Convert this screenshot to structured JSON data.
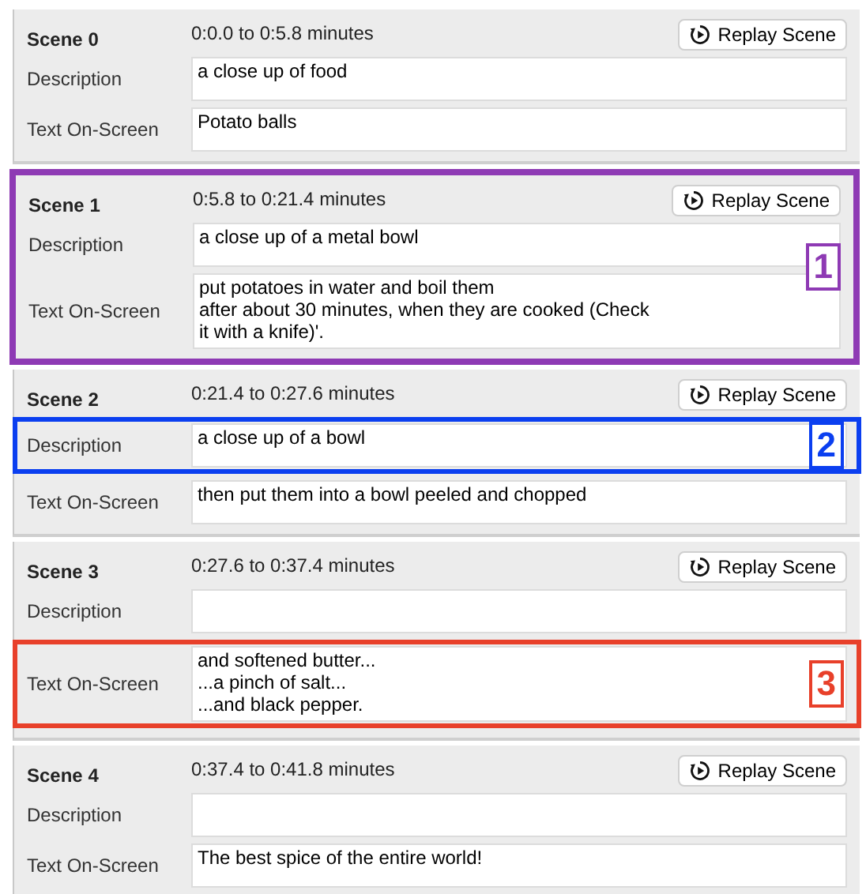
{
  "scenes": [
    {
      "title": "Scene 0",
      "time": "0:0.0 to 0:5.8 minutes",
      "replay_button": "Replay Scene",
      "description_label": "Description",
      "description": "a close up of food",
      "text_label": "Text On-Screen",
      "text_on_screen": [
        "Potato balls"
      ]
    },
    {
      "title": "Scene 1",
      "time": "0:5.8 to 0:21.4 minutes",
      "replay_button": "Replay Scene",
      "description_label": "Description",
      "description": "a close up of a metal bowl",
      "text_label": "Text On-Screen",
      "text_on_screen": [
        "put potatoes in water and boil them",
        "after about 30 minutes, when they are cooked (Check",
        "it with a knife)'."
      ],
      "scene_highlight": {
        "label": "1",
        "color": "#8e3ab4"
      }
    },
    {
      "title": "Scene 2",
      "time": "0:21.4 to 0:27.6 minutes",
      "replay_button": "Replay Scene",
      "description_label": "Description",
      "description": "a close up of a bowl",
      "text_label": "Text On-Screen",
      "text_on_screen": [
        "then put them into a bowl peeled and chopped"
      ],
      "description_highlight": {
        "label": "2",
        "color": "#0b3ff0"
      }
    },
    {
      "title": "Scene 3",
      "time": "0:27.6 to 0:37.4 minutes",
      "replay_button": "Replay Scene",
      "description_label": "Description",
      "text_label": "Text On-Screen",
      "text_on_screen": [
        "and softened butter...",
        "...a pinch of salt...",
        "...and black pepper."
      ],
      "text_highlight": {
        "label": "3",
        "color": "#e8402a"
      }
    },
    {
      "title": "Scene 4",
      "time": "0:37.4 to 0:41.8 minutes",
      "replay_button": "Replay Scene",
      "description_label": "Description",
      "text_label": "Text On-Screen",
      "text_on_screen": [
        "The best spice of the entire world!"
      ]
    }
  ]
}
